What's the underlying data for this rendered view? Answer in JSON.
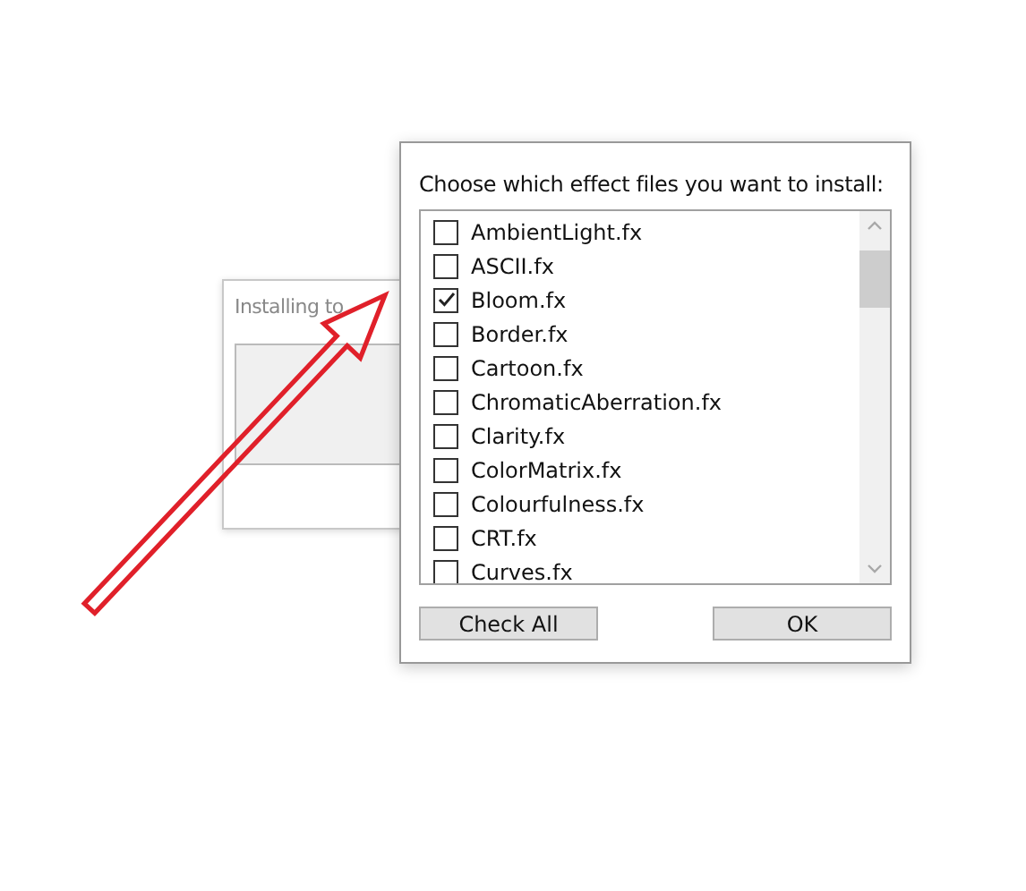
{
  "background_window": {
    "title": "Installing to"
  },
  "dialog": {
    "prompt": "Choose which effect files you want to install:",
    "files": [
      {
        "label": "AmbientLight.fx",
        "checked": false
      },
      {
        "label": "ASCII.fx",
        "checked": false
      },
      {
        "label": "Bloom.fx",
        "checked": true
      },
      {
        "label": "Border.fx",
        "checked": false
      },
      {
        "label": "Cartoon.fx",
        "checked": false
      },
      {
        "label": "ChromaticAberration.fx",
        "checked": false
      },
      {
        "label": "Clarity.fx",
        "checked": false
      },
      {
        "label": "ColorMatrix.fx",
        "checked": false
      },
      {
        "label": "Colourfulness.fx",
        "checked": false
      },
      {
        "label": "CRT.fx",
        "checked": false
      },
      {
        "label": "Curves.fx",
        "checked": false
      }
    ],
    "buttons": [
      "Check All",
      "OK"
    ]
  }
}
